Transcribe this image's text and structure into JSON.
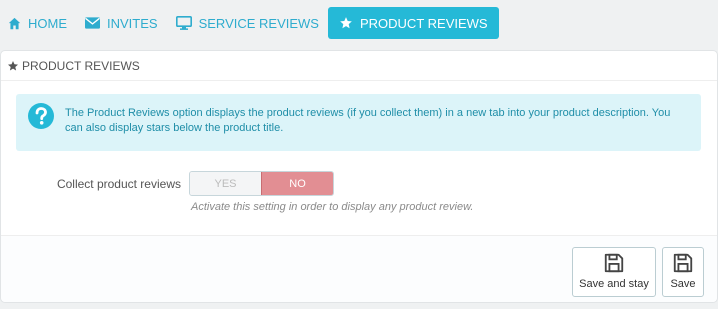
{
  "tabs": [
    {
      "label": "HOME",
      "icon": "home-icon"
    },
    {
      "label": "INVITES",
      "icon": "envelope-icon"
    },
    {
      "label": "SERVICE REVIEWS",
      "icon": "monitor-icon"
    },
    {
      "label": "PRODUCT REVIEWS",
      "icon": "star-icon",
      "active": true
    }
  ],
  "panel": {
    "title": "PRODUCT REVIEWS",
    "info": "The Product Reviews option displays the product reviews (if you collect them) in a new tab into your product description. You can also display stars below the product title.",
    "field_label": "Collect product reviews",
    "switch_yes": "YES",
    "switch_no": "NO",
    "switch_value": "NO",
    "help": "Activate this setting in order to display any product review."
  },
  "footer": {
    "save_stay_label": "Save and stay",
    "save_label": "Save"
  },
  "colors": {
    "accent": "#25b9d7",
    "no_active": "#e28e93",
    "info_bg": "#dcf4f9"
  }
}
